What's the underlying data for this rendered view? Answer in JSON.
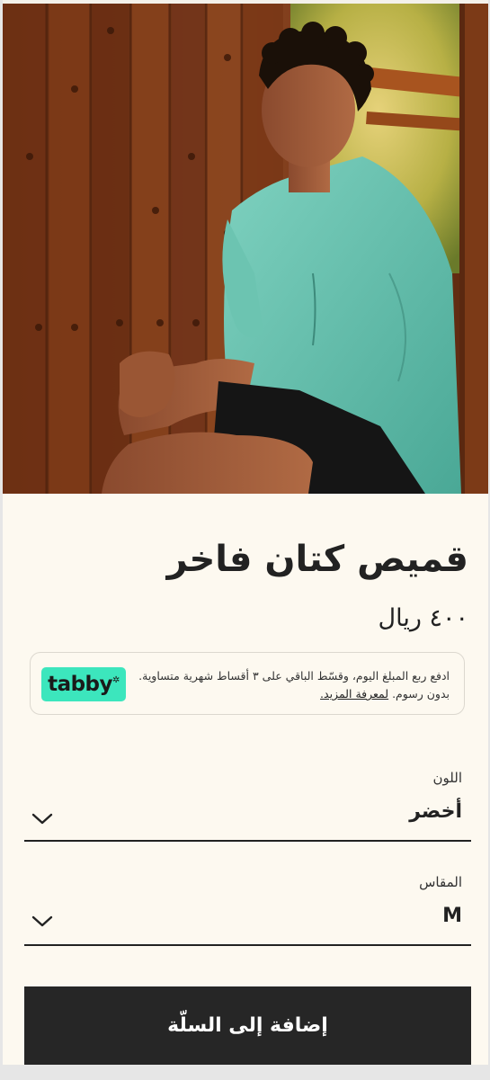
{
  "product": {
    "image_alt": "man-in-green-linen-shirt",
    "title": "قميص كتان فاخر",
    "price": "٤٠٠ ريال"
  },
  "tabby": {
    "text": "ادفع ربع المبلغ اليوم، وقسّط الباقي على ٣ أقساط شهرية متساوية. بدون رسوم.",
    "link": "لمعرفة المزيد.",
    "logo": "tabby",
    "accent": "#3ce6bd"
  },
  "color_field": {
    "label": "اللون",
    "value": "أخضر"
  },
  "size_field": {
    "label": "المقاس",
    "value": "M"
  },
  "cart": {
    "add_label": "إضافة إلى السلّة"
  },
  "colors": {
    "background": "#fdf9f0",
    "button": "#262626"
  }
}
